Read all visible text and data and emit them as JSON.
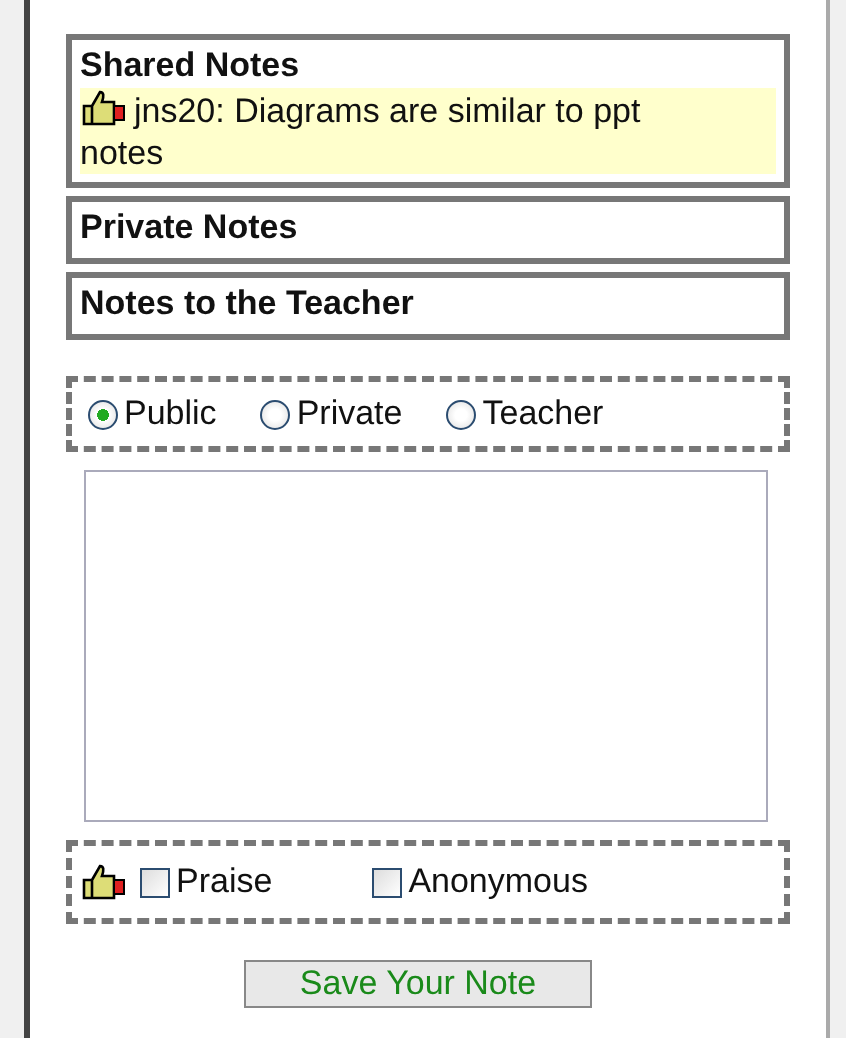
{
  "sections": [
    {
      "title": "Shared Notes",
      "notes": [
        {
          "text": "jns20: Diagrams are similar to ppt notes"
        }
      ]
    },
    {
      "title": "Private Notes"
    },
    {
      "title": "Notes to the Teacher"
    }
  ],
  "visibility": [
    {
      "label": "Public",
      "selected": true
    },
    {
      "label": "Private",
      "selected": false
    },
    {
      "label": "Teacher",
      "selected": false
    }
  ],
  "options": [
    {
      "label": "Praise",
      "checked": false
    },
    {
      "label": "Anonymous",
      "checked": false
    }
  ],
  "save_button": "Save Your Note"
}
